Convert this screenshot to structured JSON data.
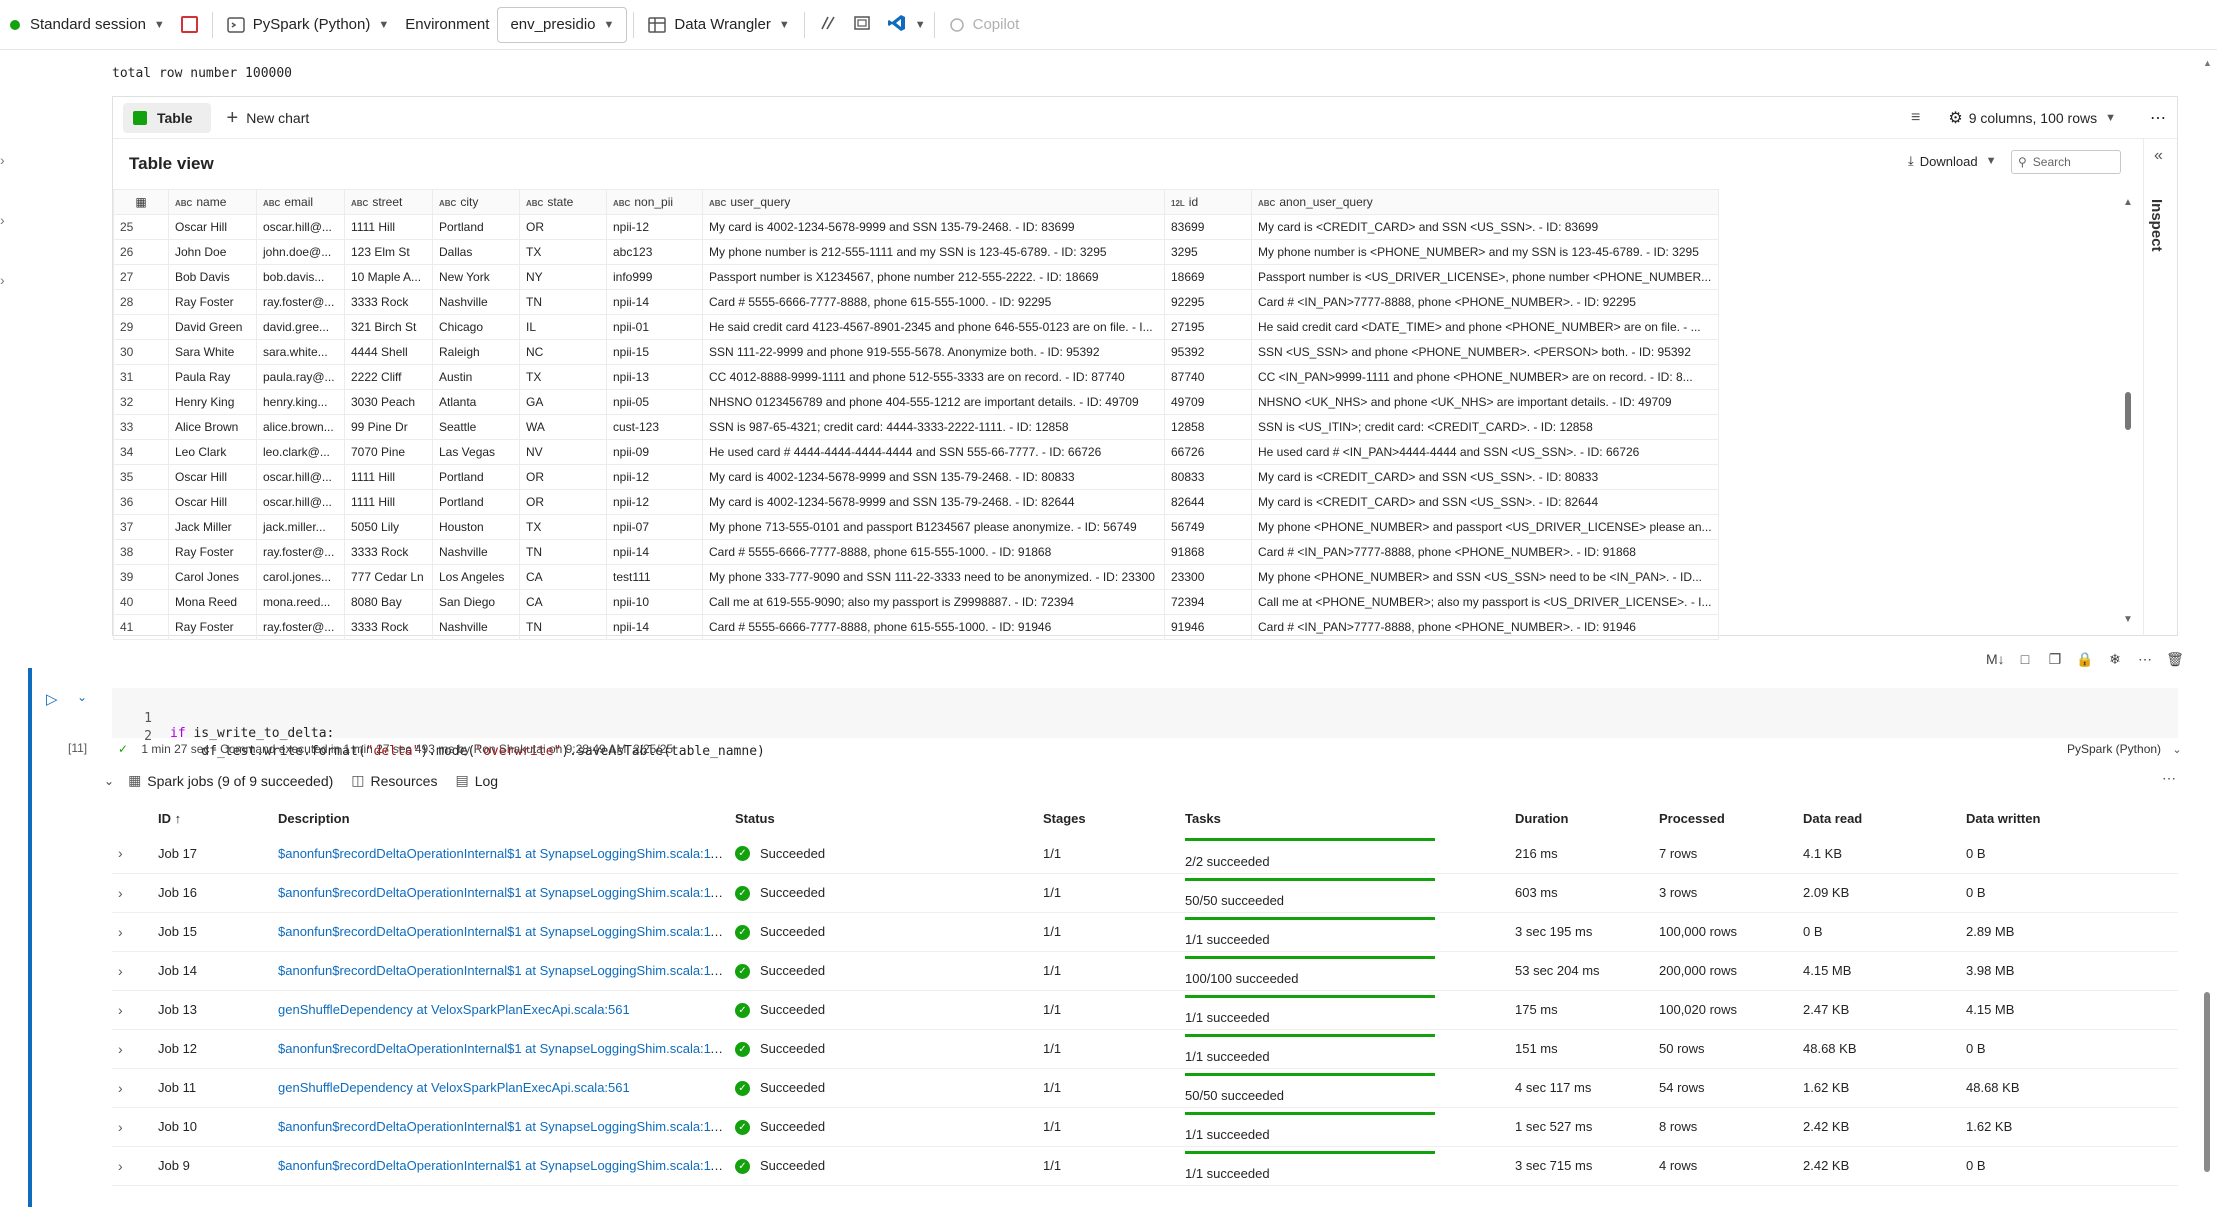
{
  "toolbar": {
    "session": "Standard session",
    "language": "PySpark (Python)",
    "environment_label": "Environment",
    "environment_value": "env_presidio",
    "data_wrangler": "Data Wrangler",
    "copilot": "Copilot"
  },
  "output": {
    "total_rows": "total row number 100000"
  },
  "panel": {
    "tab_table": "Table",
    "new_chart": "New chart",
    "columns_info": "9 columns, 100 rows",
    "table_view_title": "Table view",
    "download": "Download",
    "search_placeholder": "Search",
    "inspect": "Inspect"
  },
  "table": {
    "columns": [
      {
        "type": "ABC",
        "name": "name"
      },
      {
        "type": "ABC",
        "name": "email"
      },
      {
        "type": "ABC",
        "name": "street"
      },
      {
        "type": "ABC",
        "name": "city"
      },
      {
        "type": "ABC",
        "name": "state"
      },
      {
        "type": "ABC",
        "name": "non_pii"
      },
      {
        "type": "ABC",
        "name": "user_query"
      },
      {
        "type": "12L",
        "name": "id"
      },
      {
        "type": "ABC",
        "name": "anon_user_query"
      }
    ],
    "rows": [
      [
        "25",
        "Oscar Hill",
        "oscar.hill@...",
        "1111 Hill",
        "Portland",
        "OR",
        "npii-12",
        "My card is 4002-1234-5678-9999 and SSN 135-79-2468. - ID: 83699",
        "83699",
        "My card is <CREDIT_CARD> and SSN <US_SSN>. - ID: 83699"
      ],
      [
        "26",
        "John Doe",
        "john.doe@...",
        "123 Elm St",
        "Dallas",
        "TX",
        "abc123",
        "My phone number is 212-555-1111 and my SSN is 123-45-6789. - ID: 3295",
        "3295",
        "My phone number is <PHONE_NUMBER> and my SSN is 123-45-6789. - ID: 3295"
      ],
      [
        "27",
        "Bob Davis",
        "bob.davis...",
        "10 Maple A...",
        "New York",
        "NY",
        "info999",
        "Passport number is X1234567, phone number 212-555-2222. - ID: 18669",
        "18669",
        "Passport number is <US_DRIVER_LICENSE>, phone number <PHONE_NUMBER..."
      ],
      [
        "28",
        "Ray Foster",
        "ray.foster@...",
        "3333 Rock",
        "Nashville",
        "TN",
        "npii-14",
        "Card # 5555-6666-7777-8888, phone 615-555-1000. - ID: 92295",
        "92295",
        "Card # <IN_PAN>7777-8888, phone <PHONE_NUMBER>. - ID: 92295"
      ],
      [
        "29",
        "David Green",
        "david.gree...",
        "321 Birch St",
        "Chicago",
        "IL",
        "npii-01",
        "He said credit card 4123-4567-8901-2345 and phone 646-555-0123 are on file. - I...",
        "27195",
        "He said credit card <DATE_TIME> and phone <PHONE_NUMBER> are on file. - ..."
      ],
      [
        "30",
        "Sara White",
        "sara.white...",
        "4444 Shell",
        "Raleigh",
        "NC",
        "npii-15",
        "SSN 111-22-9999 and phone 919-555-5678. Anonymize both. - ID: 95392",
        "95392",
        "SSN <US_SSN> and phone <PHONE_NUMBER>. <PERSON> both. - ID: 95392"
      ],
      [
        "31",
        "Paula Ray",
        "paula.ray@...",
        "2222 Cliff",
        "Austin",
        "TX",
        "npii-13",
        "CC 4012-8888-9999-1111 and phone 512-555-3333 are on record. - ID: 87740",
        "87740",
        "CC <IN_PAN>9999-1111 and phone <PHONE_NUMBER> are on record. - ID: 8..."
      ],
      [
        "32",
        "Henry King",
        "henry.king...",
        "3030 Peach",
        "Atlanta",
        "GA",
        "npii-05",
        "NHSNO 0123456789 and phone 404-555-1212 are important details. - ID: 49709",
        "49709",
        "NHSNO <UK_NHS> and phone <UK_NHS> are important details. - ID: 49709"
      ],
      [
        "33",
        "Alice Brown",
        "alice.brown...",
        "99 Pine Dr",
        "Seattle",
        "WA",
        "cust-123",
        "SSN is 987-65-4321; credit card: 4444-3333-2222-1111. - ID: 12858",
        "12858",
        "SSN is <US_ITIN>; credit card: <CREDIT_CARD>. - ID: 12858"
      ],
      [
        "34",
        "Leo Clark",
        "leo.clark@...",
        "7070 Pine",
        "Las Vegas",
        "NV",
        "npii-09",
        "He used card # 4444-4444-4444-4444 and SSN 555-66-7777. - ID: 66726",
        "66726",
        "He used card # <IN_PAN>4444-4444 and SSN <US_SSN>. - ID: 66726"
      ],
      [
        "35",
        "Oscar Hill",
        "oscar.hill@...",
        "1111 Hill",
        "Portland",
        "OR",
        "npii-12",
        "My card is 4002-1234-5678-9999 and SSN 135-79-2468. - ID: 80833",
        "80833",
        "My card is <CREDIT_CARD> and SSN <US_SSN>. - ID: 80833"
      ],
      [
        "36",
        "Oscar Hill",
        "oscar.hill@...",
        "1111 Hill",
        "Portland",
        "OR",
        "npii-12",
        "My card is 4002-1234-5678-9999 and SSN 135-79-2468. - ID: 82644",
        "82644",
        "My card is <CREDIT_CARD> and SSN <US_SSN>. - ID: 82644"
      ],
      [
        "37",
        "Jack Miller",
        "jack.miller...",
        "5050 Lily",
        "Houston",
        "TX",
        "npii-07",
        "My phone 713-555-0101 and passport B1234567 please anonymize. - ID: 56749",
        "56749",
        "My phone <PHONE_NUMBER> and passport <US_DRIVER_LICENSE> please an..."
      ],
      [
        "38",
        "Ray Foster",
        "ray.foster@...",
        "3333 Rock",
        "Nashville",
        "TN",
        "npii-14",
        "Card # 5555-6666-7777-8888, phone 615-555-1000. - ID: 91868",
        "91868",
        "Card # <IN_PAN>7777-8888, phone <PHONE_NUMBER>. - ID: 91868"
      ],
      [
        "39",
        "Carol Jones",
        "carol.jones...",
        "777 Cedar Ln",
        "Los Angeles",
        "CA",
        "test111",
        "My phone 333-777-9090 and SSN 111-22-3333 need to be anonymized. - ID: 23300",
        "23300",
        "My phone <PHONE_NUMBER> and SSN <US_SSN> need to be <IN_PAN>. - ID..."
      ],
      [
        "40",
        "Mona Reed",
        "mona.reed...",
        "8080 Bay",
        "San Diego",
        "CA",
        "npii-10",
        "Call me at 619-555-9090; also my passport is Z9998887. - ID: 72394",
        "72394",
        "Call me at <PHONE_NUMBER>; also my passport is <US_DRIVER_LICENSE>. - I..."
      ],
      [
        "41",
        "Ray Foster",
        "ray.foster@...",
        "3333 Rock",
        "Nashville",
        "TN",
        "npii-14",
        "Card # 5555-6666-7777-8888, phone 615-555-1000. - ID: 91946",
        "91946",
        "Card # <IN_PAN>7777-8888, phone <PHONE_NUMBER>. - ID: 91946"
      ]
    ]
  },
  "code": {
    "line1_num": "1",
    "line2_num": "2",
    "line1_kw": "if",
    "line1_rest": " is_write_to_delta:",
    "line2_a": "    df_test.write.format(",
    "line2_s1": "\"delta\"",
    "line2_b": ").mode(",
    "line2_s2": "\"overwrite\"",
    "line2_c": ").saveAsTable(table_namne)",
    "exec_count": "[11]",
    "exec_info": "1 min 27 sec - Command executed in 1 min 27 sec 493 ms by Ron Shakutai on 9:28:49 AM, 2/25/25",
    "language": "PySpark (Python)"
  },
  "jobs": {
    "summary": "Spark jobs (9 of 9 succeeded)",
    "resources": "Resources",
    "log": "Log",
    "headers": [
      "ID ↑",
      "Description",
      "Status",
      "Stages",
      "Tasks",
      "Duration",
      "Processed",
      "Data read",
      "Data written"
    ],
    "rows": [
      {
        "id": "Job 17",
        "desc": "$anonfun$recordDeltaOperationInternal$1 at SynapseLoggingShim.scala:111",
        "status": "Succeeded",
        "stages": "1/1",
        "tasks": "2/2 succeeded",
        "duration": "216 ms",
        "processed": "7 rows",
        "read": "4.1 KB",
        "written": "0 B"
      },
      {
        "id": "Job 16",
        "desc": "$anonfun$recordDeltaOperationInternal$1 at SynapseLoggingShim.scala:111",
        "status": "Succeeded",
        "stages": "1/1",
        "tasks": "50/50 succeeded",
        "duration": "603 ms",
        "processed": "3 rows",
        "read": "2.09 KB",
        "written": "0 B"
      },
      {
        "id": "Job 15",
        "desc": "$anonfun$recordDeltaOperationInternal$1 at SynapseLoggingShim.scala:111",
        "status": "Succeeded",
        "stages": "1/1",
        "tasks": "1/1 succeeded",
        "duration": "3 sec 195 ms",
        "processed": "100,000 rows",
        "read": "0 B",
        "written": "2.89 MB"
      },
      {
        "id": "Job 14",
        "desc": "$anonfun$recordDeltaOperationInternal$1 at SynapseLoggingShim.scala:111",
        "status": "Succeeded",
        "stages": "1/1",
        "tasks": "100/100 succeeded",
        "duration": "53 sec 204 ms",
        "processed": "200,000 rows",
        "read": "4.15 MB",
        "written": "3.98 MB"
      },
      {
        "id": "Job 13",
        "desc": "genShuffleDependency at VeloxSparkPlanExecApi.scala:561",
        "status": "Succeeded",
        "stages": "1/1",
        "tasks": "1/1 succeeded",
        "duration": "175 ms",
        "processed": "100,020 rows",
        "read": "2.47 KB",
        "written": "4.15 MB"
      },
      {
        "id": "Job 12",
        "desc": "$anonfun$recordDeltaOperationInternal$1 at SynapseLoggingShim.scala:111",
        "status": "Succeeded",
        "stages": "1/1",
        "tasks": "1/1 succeeded",
        "duration": "151 ms",
        "processed": "50 rows",
        "read": "48.68 KB",
        "written": "0 B"
      },
      {
        "id": "Job 11",
        "desc": "genShuffleDependency at VeloxSparkPlanExecApi.scala:561",
        "status": "Succeeded",
        "stages": "1/1",
        "tasks": "50/50 succeeded",
        "duration": "4 sec 117 ms",
        "processed": "54 rows",
        "read": "1.62 KB",
        "written": "48.68 KB"
      },
      {
        "id": "Job 10",
        "desc": "$anonfun$recordDeltaOperationInternal$1 at SynapseLoggingShim.scala:111",
        "status": "Succeeded",
        "stages": "1/1",
        "tasks": "1/1 succeeded",
        "duration": "1 sec 527 ms",
        "processed": "8 rows",
        "read": "2.42 KB",
        "written": "1.62 KB"
      },
      {
        "id": "Job 9",
        "desc": "$anonfun$recordDeltaOperationInternal$1 at SynapseLoggingShim.scala:111",
        "status": "Succeeded",
        "stages": "1/1",
        "tasks": "1/1 succeeded",
        "duration": "3 sec 715 ms",
        "processed": "4 rows",
        "read": "2.42 KB",
        "written": "0 B"
      }
    ]
  },
  "colors": {
    "accent": "#0f6cbd",
    "success": "#13a10e"
  }
}
